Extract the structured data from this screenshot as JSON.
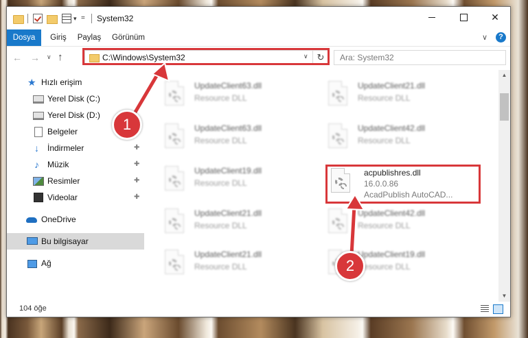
{
  "window": {
    "title": "System32",
    "qa_arrow": "▾",
    "close_symbol": "✕"
  },
  "ribbon": {
    "tabs": [
      "Dosya",
      "Giriş",
      "Paylaş",
      "Görünüm"
    ],
    "chevron": "∨",
    "help": "?"
  },
  "address": {
    "path": "C:\\Windows\\System32",
    "back": "←",
    "forward": "→",
    "recent": "∨",
    "up": "↑",
    "dropdown": "∨",
    "refresh": "↻"
  },
  "search": {
    "placeholder": "Ara: System32"
  },
  "sidebar": {
    "items": [
      {
        "label": "Hızlı erişim",
        "icon": "star-icon"
      },
      {
        "label": "Yerel Disk (C:)",
        "icon": "disk-icon"
      },
      {
        "label": "Yerel Disk (D:)",
        "icon": "disk-icon"
      },
      {
        "label": "Belgeler",
        "icon": "documents-icon"
      },
      {
        "label": "İndirmeler",
        "icon": "download-icon",
        "pinned": true
      },
      {
        "label": "Müzik",
        "icon": "music-icon",
        "pinned": true
      },
      {
        "label": "Resimler",
        "icon": "pictures-icon",
        "pinned": true
      },
      {
        "label": "Videolar",
        "icon": "video-icon",
        "pinned": true
      },
      {
        "label": "OneDrive",
        "icon": "cloud-icon"
      },
      {
        "label": "Bu bilgisayar",
        "icon": "computer-icon",
        "selected": true
      },
      {
        "label": "Ağ",
        "icon": "network-icon"
      }
    ],
    "pin_glyph": "📌"
  },
  "files": [
    {
      "name": "UpdateClient63.dll",
      "type": "Resource DLL"
    },
    {
      "name": "UpdateClient21.dll",
      "type": "Resource DLL"
    },
    {
      "name": "UpdateClient63.dll",
      "type": "Resource DLL"
    },
    {
      "name": "UpdateClient42.dll",
      "type": "Resource DLL"
    },
    {
      "name": "UpdateClient19.dll",
      "type": "Resource DLL"
    },
    {
      "name": "acpublishres.dll",
      "version": "16.0.0.86",
      "description": "AcadPublish AutoCAD..."
    },
    {
      "name": "UpdateClient21.dll",
      "type": "Resource DLL"
    },
    {
      "name": "UpdateClient42.dll",
      "type": "Resource DLL"
    },
    {
      "name": "UpdateClient21.dll",
      "type": "Resource DLL"
    },
    {
      "name": "UpdateClient19.dll",
      "type": "Resource DLL"
    }
  ],
  "status": {
    "item_count": "104 öğe"
  },
  "annotations": {
    "step1": "1",
    "step2": "2",
    "color": "#d8373a"
  }
}
